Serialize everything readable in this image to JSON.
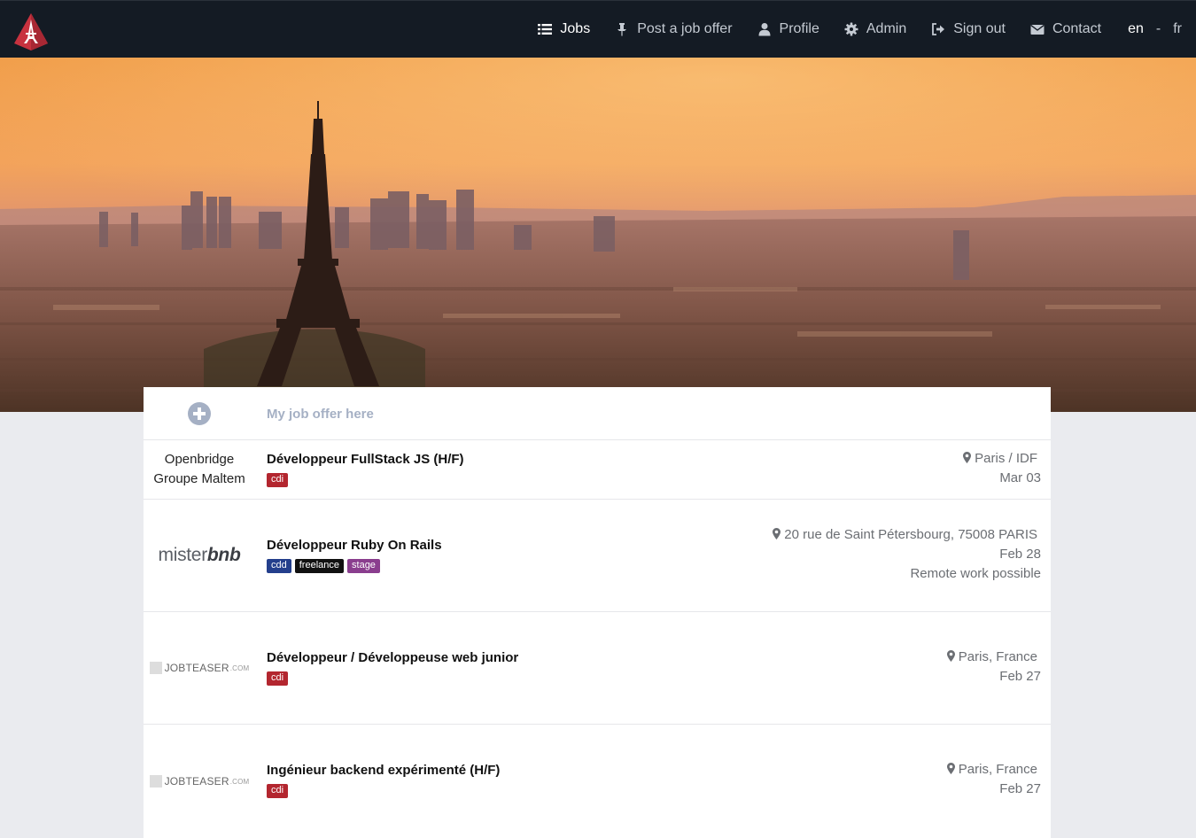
{
  "nav": {
    "items": [
      {
        "label": "Jobs",
        "icon": "list-icon",
        "active": true
      },
      {
        "label": "Post a job offer",
        "icon": "pin-icon",
        "active": false
      },
      {
        "label": "Profile",
        "icon": "user-icon",
        "active": false
      },
      {
        "label": "Admin",
        "icon": "gear-icon",
        "active": false
      },
      {
        "label": "Sign out",
        "icon": "sign-out-icon",
        "active": false
      },
      {
        "label": "Contact",
        "icon": "envelope-icon",
        "active": false
      }
    ],
    "lang": {
      "current": "en",
      "separator": "-",
      "other": "fr"
    }
  },
  "brand": {
    "icon": "eiffel-tower-logo-icon",
    "color": "#d03a45"
  },
  "jobs": {
    "add_label": "My job offer here",
    "list": [
      {
        "company_lines": [
          "Openbridge",
          "Groupe Maltem"
        ],
        "title": "Développeur FullStack JS (H/F)",
        "tags": [
          {
            "label": "cdi",
            "color": "#b3262f"
          }
        ],
        "location": "Paris / IDF",
        "date": "Mar 03",
        "extra": ""
      },
      {
        "company_logo": {
          "prefix": "mister",
          "suffix": "bnb"
        },
        "title": "Développeur Ruby On Rails",
        "tags": [
          {
            "label": "cdd",
            "color": "#243f8c"
          },
          {
            "label": "freelance",
            "color": "#111111"
          },
          {
            "label": "stage",
            "color": "#8a3e8e"
          }
        ],
        "location": "20 rue de Saint Pétersbourg, 75008 PARIS",
        "date": "Feb 28",
        "extra": "Remote work possible"
      },
      {
        "company_logo": {
          "name": "JOBTEASER",
          "suffix": ".COM"
        },
        "title": "Développeur / Développeuse web junior",
        "tags": [
          {
            "label": "cdi",
            "color": "#b3262f"
          }
        ],
        "location": "Paris, France",
        "date": "Feb 27",
        "extra": ""
      },
      {
        "company_logo": {
          "name": "JOBTEASER",
          "suffix": ".COM"
        },
        "title": "Ingénieur backend expérimenté (H/F)",
        "tags": [
          {
            "label": "cdi",
            "color": "#b3262f"
          }
        ],
        "location": "Paris, France",
        "date": "Feb 27",
        "extra": ""
      }
    ]
  }
}
